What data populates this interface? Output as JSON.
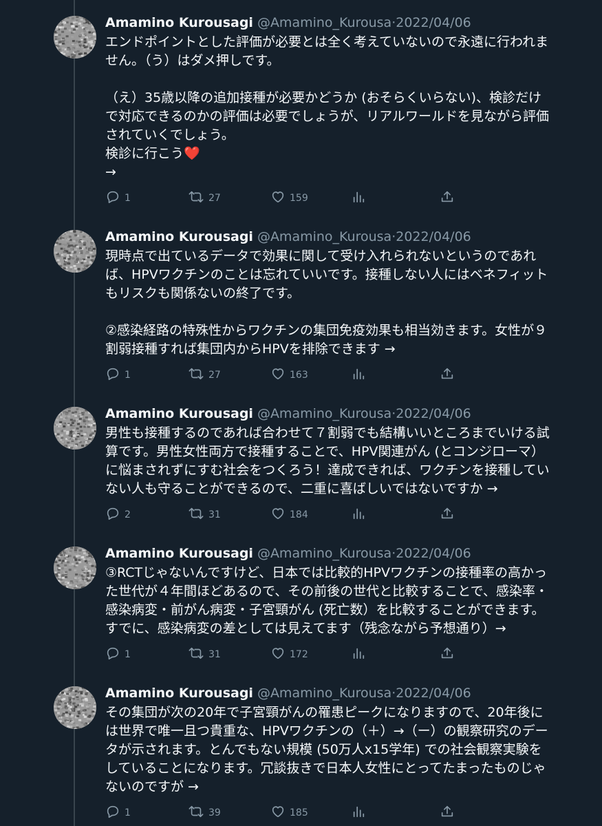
{
  "tweets": [
    {
      "name": "Amamino Kurousagi",
      "handle": "@Amamino_Kurousa",
      "separator": "·",
      "date": "2022/04/06",
      "paragraphs": [
        "エンドポイントとした評価が必要とは全く考えていないので永遠に行われません。（う）はダメ押しです。",
        "",
        "（え）35歳以降の追加接種が必要かどうか (おそらくいらない)、検診だけで対応できるのかの評価は必要でしょうが、リアルワールドを見ながら評価されていくでしょう。",
        "検診に行こう❤️",
        "→"
      ],
      "replies": "1",
      "retweets": "27",
      "likes": "159"
    },
    {
      "name": "Amamino Kurousagi",
      "handle": "@Amamino_Kurousa",
      "separator": "·",
      "date": "2022/04/06",
      "paragraphs": [
        "現時点で出ているデータで効果に関して受け入れられないというのであれば、HPVワクチンのことは忘れていいです。接種しない人にはベネフィットもリスクも関係ないの終了です。",
        "",
        "②感染経路の特殊性からワクチンの集団免疫効果も相当効きます。女性が９割弱接種すれば集団内からHPVを排除できます →"
      ],
      "replies": "1",
      "retweets": "27",
      "likes": "163"
    },
    {
      "name": "Amamino Kurousagi",
      "handle": "@Amamino_Kurousa",
      "separator": "·",
      "date": "2022/04/06",
      "paragraphs": [
        "男性も接種するのであれば合わせて７割弱でも結構いいところまでいける試算です。男性女性両方で接種することで、HPV関連がん (とコンジローマ）に悩まされずにすむ社会をつくろう！達成できれば、ワクチンを接種していない人も守ることができるので、二重に喜ばしいではないですか →"
      ],
      "replies": "2",
      "retweets": "31",
      "likes": "184"
    },
    {
      "name": "Amamino Kurousagi",
      "handle": "@Amamino_Kurousa",
      "separator": "·",
      "date": "2022/04/06",
      "paragraphs": [
        "③RCTじゃないんですけど、日本では比較的HPVワクチンの接種率の高かった世代が４年間ほどあるので、その前後の世代と比較することで、感染率・感染病変・前がん病変・子宮頸がん (死亡数）を比較することができます。すでに、感染病変の差としては見えてます（残念ながら予想通り）→"
      ],
      "replies": "1",
      "retweets": "31",
      "likes": "172"
    },
    {
      "name": "Amamino Kurousagi",
      "handle": "@Amamino_Kurousa",
      "separator": "·",
      "date": "2022/04/06",
      "paragraphs": [
        "その集団が次の20年で子宮頸がんの罹患ピークになりますので、20年後には世界で唯一且つ貴重な、HPVワクチンの（＋）→（ー）の観察研究のデータが示されます。とんでもない規模 (50万人x15学年) での社会観察実験をしていることになります。冗談抜きで日本人女性にとってたまったものじゃないのですが →"
      ],
      "replies": "1",
      "retweets": "39",
      "likes": "185"
    }
  ],
  "icons": {
    "reply": "reply-icon",
    "retweet": "retweet-icon",
    "like": "heart-icon",
    "views": "views-icon",
    "share": "share-icon"
  },
  "colors": {
    "background": "#15202b",
    "text": "#f5f8fa",
    "secondary": "#8899a6",
    "thread_line": "#38444d"
  }
}
